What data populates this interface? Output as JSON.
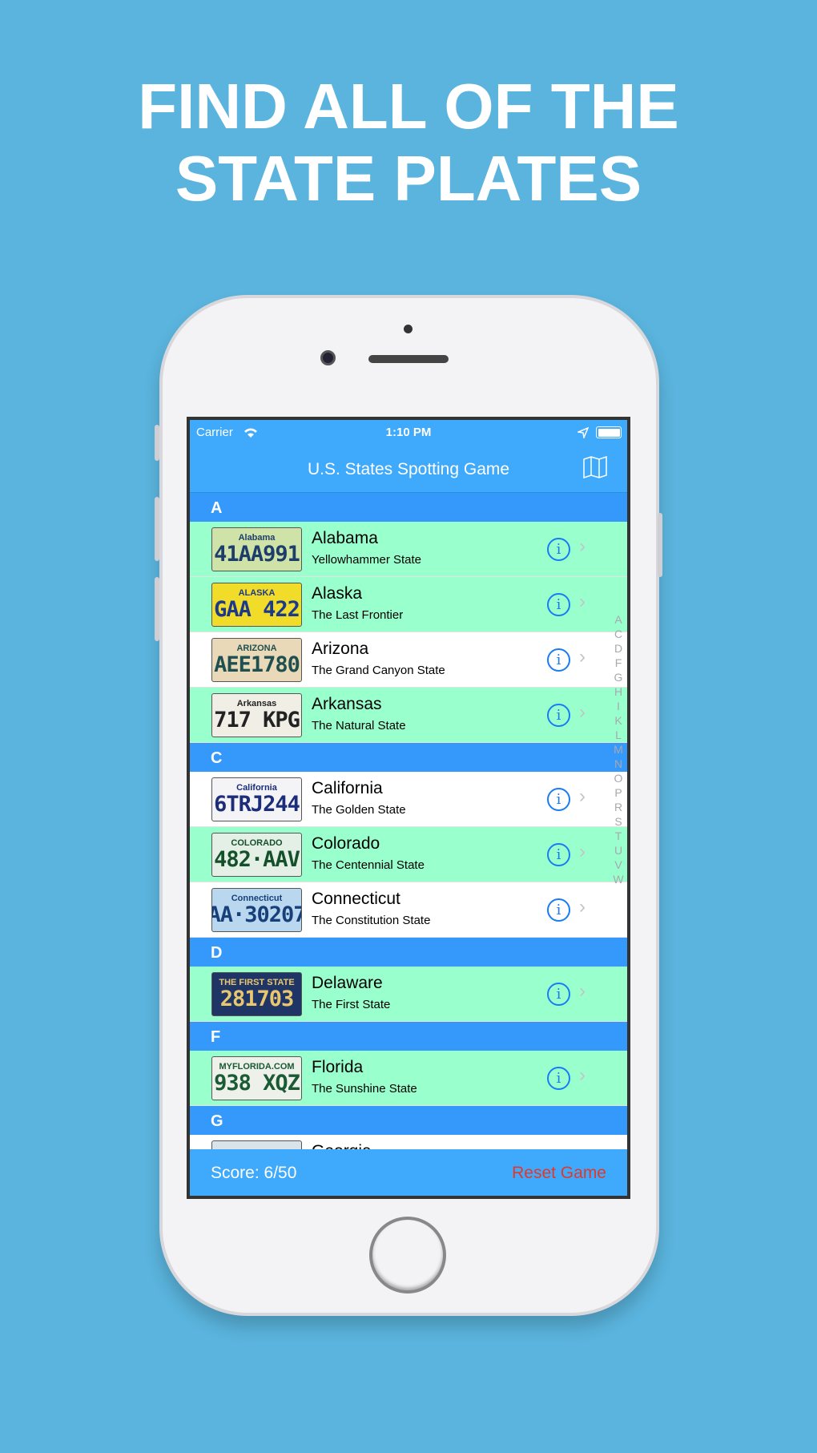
{
  "headline": {
    "line1": "FIND ALL OF THE",
    "line2": "STATE PLATES"
  },
  "status": {
    "carrier": "Carrier",
    "time": "1:10 PM"
  },
  "nav": {
    "title": "U.S. States Spotting Game",
    "map_icon": "map-icon"
  },
  "sections": [
    {
      "letter": "A",
      "rows": [
        {
          "name": "Alabama",
          "nickname": "Yellowhammer State",
          "found": true,
          "plate_top": "Alabama",
          "plate_num": "41AA991",
          "plate_bg": "#cfe3a8",
          "plate_fg": "#1d3d6a"
        },
        {
          "name": "Alaska",
          "nickname": "The Last Frontier",
          "found": true,
          "plate_top": "ALASKA",
          "plate_num": "GAA 422",
          "plate_bg": "#f1dc2a",
          "plate_fg": "#1c3a8c"
        },
        {
          "name": "Arizona",
          "nickname": "The Grand Canyon State",
          "found": false,
          "plate_top": "ARIZONA",
          "plate_num": "AEE1780",
          "plate_bg": "#e9d9b8",
          "plate_fg": "#1f4f4f"
        },
        {
          "name": "Arkansas",
          "nickname": "The Natural State",
          "found": true,
          "plate_top": "Arkansas",
          "plate_num": "717 KPG",
          "plate_bg": "#f1eee6",
          "plate_fg": "#222"
        }
      ]
    },
    {
      "letter": "C",
      "rows": [
        {
          "name": "California",
          "nickname": "The Golden State",
          "found": false,
          "plate_top": "California",
          "plate_num": "6TRJ244",
          "plate_bg": "#f4f4f6",
          "plate_fg": "#1c2d7a"
        },
        {
          "name": "Colorado",
          "nickname": "The Centennial State",
          "found": true,
          "plate_top": "COLORADO",
          "plate_num": "482·AAV",
          "plate_bg": "#e4efe6",
          "plate_fg": "#14502a"
        },
        {
          "name": "Connecticut",
          "nickname": "The Constitution State",
          "found": false,
          "plate_top": "Connecticut",
          "plate_num": "AA·30207",
          "plate_bg": "#b9d7ee",
          "plate_fg": "#173f7a"
        }
      ]
    },
    {
      "letter": "D",
      "rows": [
        {
          "name": "Delaware",
          "nickname": "The First State",
          "found": true,
          "plate_top": "THE FIRST STATE",
          "plate_num": "281703",
          "plate_bg": "#1f3566",
          "plate_fg": "#e9c770"
        }
      ]
    },
    {
      "letter": "F",
      "rows": [
        {
          "name": "Florida",
          "nickname": "The Sunshine State",
          "found": true,
          "plate_top": "MYFLORIDA.COM",
          "plate_num": "938 XQZ",
          "plate_bg": "#eef0ea",
          "plate_fg": "#1a5a35"
        }
      ]
    },
    {
      "letter": "G",
      "rows": [
        {
          "name": "Georgia",
          "nickname": "",
          "found": false,
          "plate_top": "GEORGIA",
          "plate_num": "",
          "plate_bg": "#d9e4ea",
          "plate_fg": "#333"
        }
      ]
    }
  ],
  "index_letters": [
    "A",
    "C",
    "D",
    "F",
    "G",
    "H",
    "I",
    "K",
    "L",
    "M",
    "N",
    "O",
    "P",
    "R",
    "S",
    "T",
    "U",
    "V",
    "W"
  ],
  "toolbar": {
    "score": "Score: 6/50",
    "reset": "Reset Game"
  },
  "colors": {
    "background": "#5ab4dd",
    "bar": "#3fa9fb",
    "section": "#3598fb",
    "found_row": "#99ffcc",
    "reset": "#e0392b",
    "info": "#1a7cf5"
  }
}
